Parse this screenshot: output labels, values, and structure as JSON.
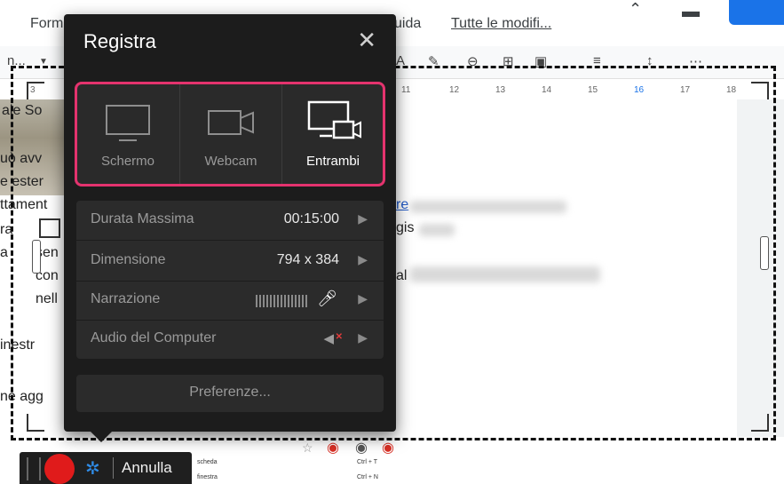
{
  "docs": {
    "menu": [
      "Form",
      "uida",
      "Tutte le modifi..."
    ],
    "font_name": "n...",
    "ruler_ticks": [
      "3",
      "11",
      "12",
      "13",
      "14",
      "15",
      "16",
      "17",
      "18"
    ],
    "text_lines": [
      "ale So",
      "uò avv",
      "e ester",
      "ttament",
      "ra",
      "a",
      "sen",
      "con",
      "nell",
      "inestr",
      "ne agg"
    ],
    "side_text": [
      "re",
      "gis",
      "al"
    ],
    "context_menu": {
      "item1": "scheda",
      "item2": "finestra",
      "shortcut1": "Ctrl + T",
      "shortcut2": "Ctrl + N"
    }
  },
  "dialog": {
    "title": "Registra",
    "close_glyph": "✕",
    "capture_options": [
      {
        "label": "Schermo",
        "icon": "monitor-icon",
        "active": false
      },
      {
        "label": "Webcam",
        "icon": "webcam-icon",
        "active": false
      },
      {
        "label": "Entrambi",
        "icon": "monitor-webcam-icon",
        "active": true
      }
    ],
    "settings": {
      "max_duration_label": "Durata Massima",
      "max_duration_value": "00:15:00",
      "size_label": "Dimensione",
      "size_value": "794 x 384",
      "narration_label": "Narrazione",
      "computer_audio_label": "Audio del Computer"
    },
    "preferences_label": "Preferenze...",
    "accent_color": "#e4336e"
  },
  "recorder_bar": {
    "cancel_label": "Annulla",
    "record_color": "#e01b1b"
  }
}
